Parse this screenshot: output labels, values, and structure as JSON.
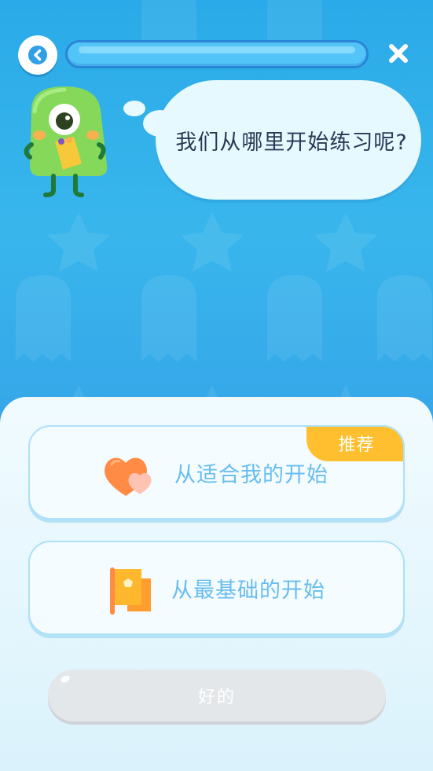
{
  "header": {
    "back_icon": "chevron-left-icon",
    "close_icon": "close-icon",
    "progress": 0.0
  },
  "mascot": {
    "icon": "green-monster-mascot"
  },
  "speech": {
    "text": "我们从哪里开始练习呢?"
  },
  "options": [
    {
      "label": "从适合我的开始",
      "icon": "hearts-icon",
      "badge": "推荐"
    },
    {
      "label": "从最基础的开始",
      "icon": "flag-icon"
    }
  ],
  "confirm": {
    "label": "好的"
  },
  "colors": {
    "accent": "#2aaae8",
    "option_text": "#68bdef",
    "badge": "#ffbf2e",
    "button_disabled": "#e4e7ea"
  }
}
